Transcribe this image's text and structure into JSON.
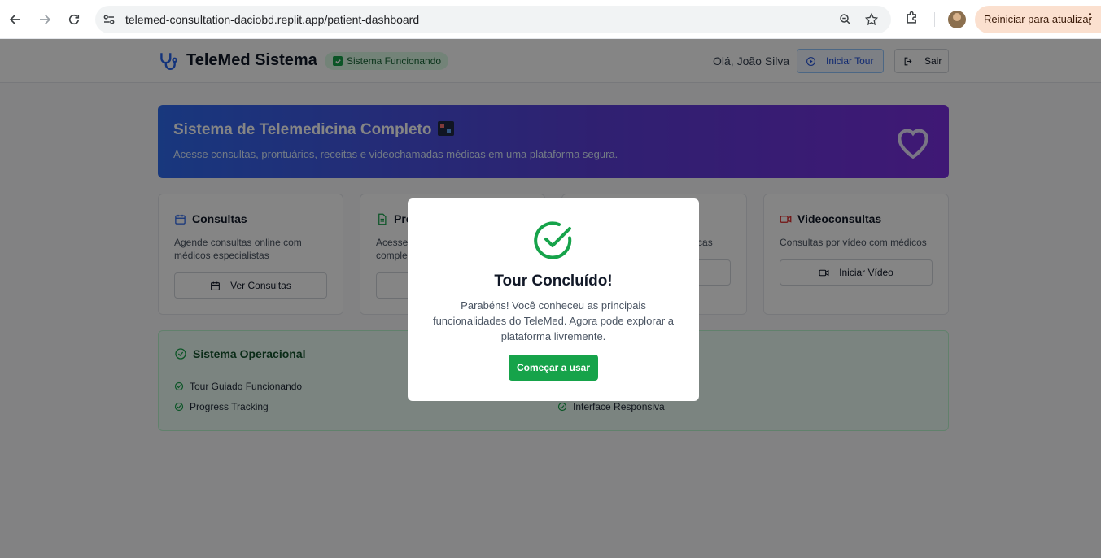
{
  "browser": {
    "url": "telemed-consultation-daciobd.replit.app/patient-dashboard",
    "update_button": "Reiniciar para atualizar",
    "icons": [
      "back-icon",
      "forward-icon",
      "reload-icon",
      "site-settings-icon",
      "zoom-icon",
      "star-icon",
      "extensions-icon",
      "profile-avatar",
      "menu-kebab-icon"
    ]
  },
  "header": {
    "title": "TeleMed Sistema",
    "status_badge": "Sistema Funcionando",
    "greeting": "Olá, João Silva",
    "tour_button": "Iniciar Tour",
    "exit_button": "Sair"
  },
  "hero": {
    "title": "Sistema de Telemedicina Completo",
    "subtitle": "Acesse consultas, prontuários, receitas e videochamadas médicas em uma plataforma segura."
  },
  "cards": [
    {
      "title": "Consultas",
      "description": "Agende consultas online com médicos especialistas",
      "button": "Ver Consultas"
    },
    {
      "title": "Pro",
      "description": "Acesse",
      "description2": "comple",
      "button": ""
    },
    {
      "title": "",
      "description": "édicas",
      "button": ""
    },
    {
      "title": "Videoconsultas",
      "description": "Consultas por vídeo com médicos",
      "button": "Iniciar Vídeo"
    }
  ],
  "operational": {
    "title": "Sistema Operacional",
    "items": [
      "Tour Guiado Funcionando",
      "Progress Tracking",
      "Interface Responsiva"
    ]
  },
  "modal": {
    "title": "Tour Concluído!",
    "text": "Parabéns! Você conheceu as principais funcionalidades do TeleMed. Agora pode explorar a plataforma livremente.",
    "button": "Começar a usar"
  },
  "colors": {
    "primary_blue": "#2563eb",
    "accent_green": "#16a34a",
    "hero_gradient_start": "#2f6bf0",
    "hero_gradient_end": "#7a2fe0",
    "video_red": "#dc2626"
  }
}
